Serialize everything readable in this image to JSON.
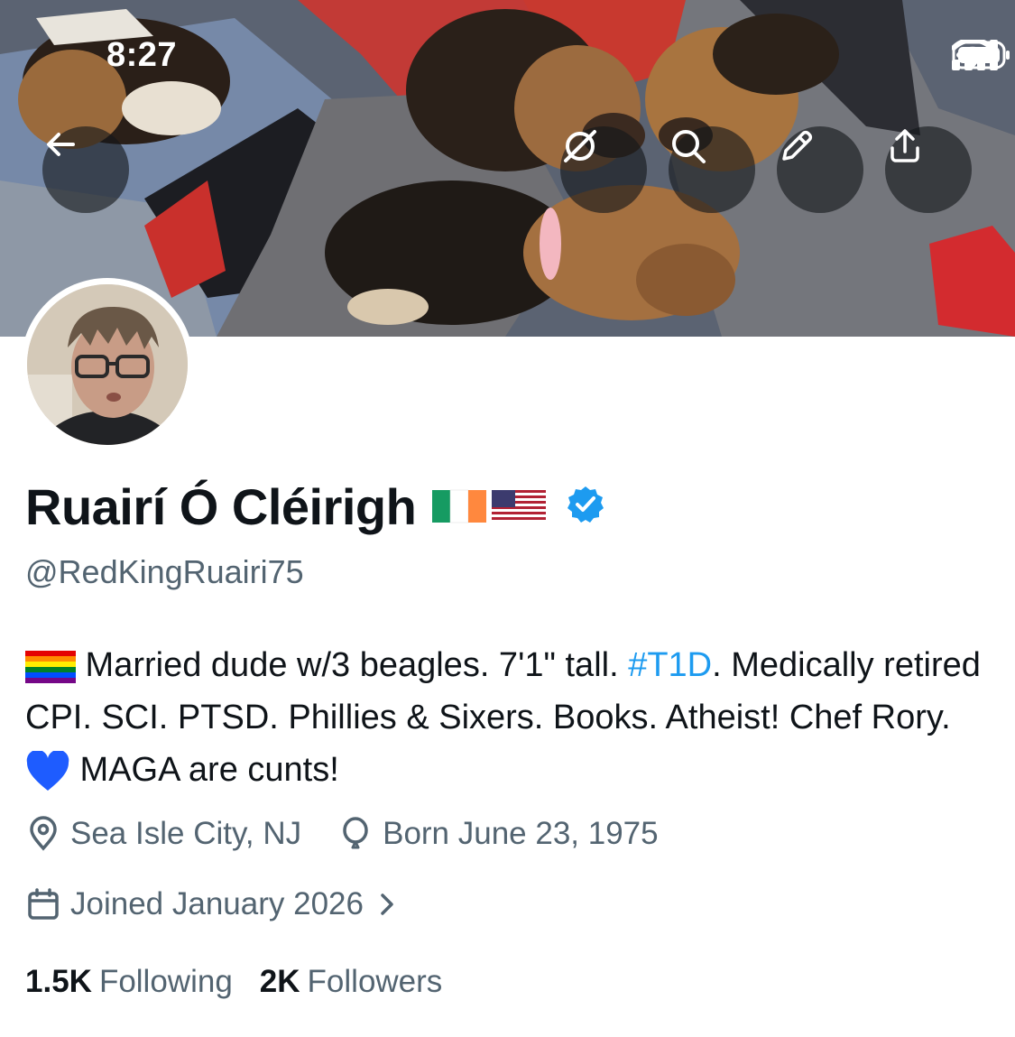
{
  "status_bar": {
    "time": "8:27"
  },
  "header_actions": {
    "back": "back-arrow-icon",
    "grok": "grok-icon",
    "search": "search-icon",
    "edit": "pencil-icon",
    "share": "share-icon"
  },
  "profile": {
    "display_name": "Ruairí Ó Cléirigh",
    "handle": "@RedKingRuairi75",
    "verified": true,
    "bio": {
      "part1": " Married dude w/3 beagles. 7'1\" tall. ",
      "hashtag": "#T1D",
      "part2": ". Medically retired CPI. SCI. PTSD. Phillies & Sixers. Books. Atheist! Chef Rory. ",
      "part3": " MAGA are cunts!"
    },
    "location": "Sea Isle City, NJ",
    "birthday": "Born June 23, 1975",
    "joined": "Joined January 2026",
    "following_count": "1.5K",
    "following_label": "Following",
    "followers_count": "2K",
    "followers_label": "Followers"
  },
  "colors": {
    "text_primary": "#0f1419",
    "text_secondary": "#536471",
    "link": "#1d9bf0",
    "verified": "#1d9bf0"
  }
}
